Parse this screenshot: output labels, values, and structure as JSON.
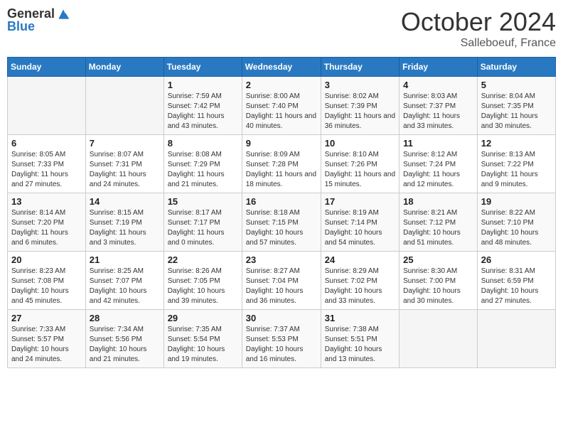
{
  "header": {
    "logo_line1": "General",
    "logo_line2": "Blue",
    "month_title": "October 2024",
    "location": "Salleboeuf, France"
  },
  "weekdays": [
    "Sunday",
    "Monday",
    "Tuesday",
    "Wednesday",
    "Thursday",
    "Friday",
    "Saturday"
  ],
  "weeks": [
    [
      {
        "day": "",
        "sunrise": "",
        "sunset": "",
        "daylight": ""
      },
      {
        "day": "",
        "sunrise": "",
        "sunset": "",
        "daylight": ""
      },
      {
        "day": "1",
        "sunrise": "Sunrise: 7:59 AM",
        "sunset": "Sunset: 7:42 PM",
        "daylight": "Daylight: 11 hours and 43 minutes."
      },
      {
        "day": "2",
        "sunrise": "Sunrise: 8:00 AM",
        "sunset": "Sunset: 7:40 PM",
        "daylight": "Daylight: 11 hours and 40 minutes."
      },
      {
        "day": "3",
        "sunrise": "Sunrise: 8:02 AM",
        "sunset": "Sunset: 7:39 PM",
        "daylight": "Daylight: 11 hours and 36 minutes."
      },
      {
        "day": "4",
        "sunrise": "Sunrise: 8:03 AM",
        "sunset": "Sunset: 7:37 PM",
        "daylight": "Daylight: 11 hours and 33 minutes."
      },
      {
        "day": "5",
        "sunrise": "Sunrise: 8:04 AM",
        "sunset": "Sunset: 7:35 PM",
        "daylight": "Daylight: 11 hours and 30 minutes."
      }
    ],
    [
      {
        "day": "6",
        "sunrise": "Sunrise: 8:05 AM",
        "sunset": "Sunset: 7:33 PM",
        "daylight": "Daylight: 11 hours and 27 minutes."
      },
      {
        "day": "7",
        "sunrise": "Sunrise: 8:07 AM",
        "sunset": "Sunset: 7:31 PM",
        "daylight": "Daylight: 11 hours and 24 minutes."
      },
      {
        "day": "8",
        "sunrise": "Sunrise: 8:08 AM",
        "sunset": "Sunset: 7:29 PM",
        "daylight": "Daylight: 11 hours and 21 minutes."
      },
      {
        "day": "9",
        "sunrise": "Sunrise: 8:09 AM",
        "sunset": "Sunset: 7:28 PM",
        "daylight": "Daylight: 11 hours and 18 minutes."
      },
      {
        "day": "10",
        "sunrise": "Sunrise: 8:10 AM",
        "sunset": "Sunset: 7:26 PM",
        "daylight": "Daylight: 11 hours and 15 minutes."
      },
      {
        "day": "11",
        "sunrise": "Sunrise: 8:12 AM",
        "sunset": "Sunset: 7:24 PM",
        "daylight": "Daylight: 11 hours and 12 minutes."
      },
      {
        "day": "12",
        "sunrise": "Sunrise: 8:13 AM",
        "sunset": "Sunset: 7:22 PM",
        "daylight": "Daylight: 11 hours and 9 minutes."
      }
    ],
    [
      {
        "day": "13",
        "sunrise": "Sunrise: 8:14 AM",
        "sunset": "Sunset: 7:20 PM",
        "daylight": "Daylight: 11 hours and 6 minutes."
      },
      {
        "day": "14",
        "sunrise": "Sunrise: 8:15 AM",
        "sunset": "Sunset: 7:19 PM",
        "daylight": "Daylight: 11 hours and 3 minutes."
      },
      {
        "day": "15",
        "sunrise": "Sunrise: 8:17 AM",
        "sunset": "Sunset: 7:17 PM",
        "daylight": "Daylight: 11 hours and 0 minutes."
      },
      {
        "day": "16",
        "sunrise": "Sunrise: 8:18 AM",
        "sunset": "Sunset: 7:15 PM",
        "daylight": "Daylight: 10 hours and 57 minutes."
      },
      {
        "day": "17",
        "sunrise": "Sunrise: 8:19 AM",
        "sunset": "Sunset: 7:14 PM",
        "daylight": "Daylight: 10 hours and 54 minutes."
      },
      {
        "day": "18",
        "sunrise": "Sunrise: 8:21 AM",
        "sunset": "Sunset: 7:12 PM",
        "daylight": "Daylight: 10 hours and 51 minutes."
      },
      {
        "day": "19",
        "sunrise": "Sunrise: 8:22 AM",
        "sunset": "Sunset: 7:10 PM",
        "daylight": "Daylight: 10 hours and 48 minutes."
      }
    ],
    [
      {
        "day": "20",
        "sunrise": "Sunrise: 8:23 AM",
        "sunset": "Sunset: 7:08 PM",
        "daylight": "Daylight: 10 hours and 45 minutes."
      },
      {
        "day": "21",
        "sunrise": "Sunrise: 8:25 AM",
        "sunset": "Sunset: 7:07 PM",
        "daylight": "Daylight: 10 hours and 42 minutes."
      },
      {
        "day": "22",
        "sunrise": "Sunrise: 8:26 AM",
        "sunset": "Sunset: 7:05 PM",
        "daylight": "Daylight: 10 hours and 39 minutes."
      },
      {
        "day": "23",
        "sunrise": "Sunrise: 8:27 AM",
        "sunset": "Sunset: 7:04 PM",
        "daylight": "Daylight: 10 hours and 36 minutes."
      },
      {
        "day": "24",
        "sunrise": "Sunrise: 8:29 AM",
        "sunset": "Sunset: 7:02 PM",
        "daylight": "Daylight: 10 hours and 33 minutes."
      },
      {
        "day": "25",
        "sunrise": "Sunrise: 8:30 AM",
        "sunset": "Sunset: 7:00 PM",
        "daylight": "Daylight: 10 hours and 30 minutes."
      },
      {
        "day": "26",
        "sunrise": "Sunrise: 8:31 AM",
        "sunset": "Sunset: 6:59 PM",
        "daylight": "Daylight: 10 hours and 27 minutes."
      }
    ],
    [
      {
        "day": "27",
        "sunrise": "Sunrise: 7:33 AM",
        "sunset": "Sunset: 5:57 PM",
        "daylight": "Daylight: 10 hours and 24 minutes."
      },
      {
        "day": "28",
        "sunrise": "Sunrise: 7:34 AM",
        "sunset": "Sunset: 5:56 PM",
        "daylight": "Daylight: 10 hours and 21 minutes."
      },
      {
        "day": "29",
        "sunrise": "Sunrise: 7:35 AM",
        "sunset": "Sunset: 5:54 PM",
        "daylight": "Daylight: 10 hours and 19 minutes."
      },
      {
        "day": "30",
        "sunrise": "Sunrise: 7:37 AM",
        "sunset": "Sunset: 5:53 PM",
        "daylight": "Daylight: 10 hours and 16 minutes."
      },
      {
        "day": "31",
        "sunrise": "Sunrise: 7:38 AM",
        "sunset": "Sunset: 5:51 PM",
        "daylight": "Daylight: 10 hours and 13 minutes."
      },
      {
        "day": "",
        "sunrise": "",
        "sunset": "",
        "daylight": ""
      },
      {
        "day": "",
        "sunrise": "",
        "sunset": "",
        "daylight": ""
      }
    ]
  ]
}
